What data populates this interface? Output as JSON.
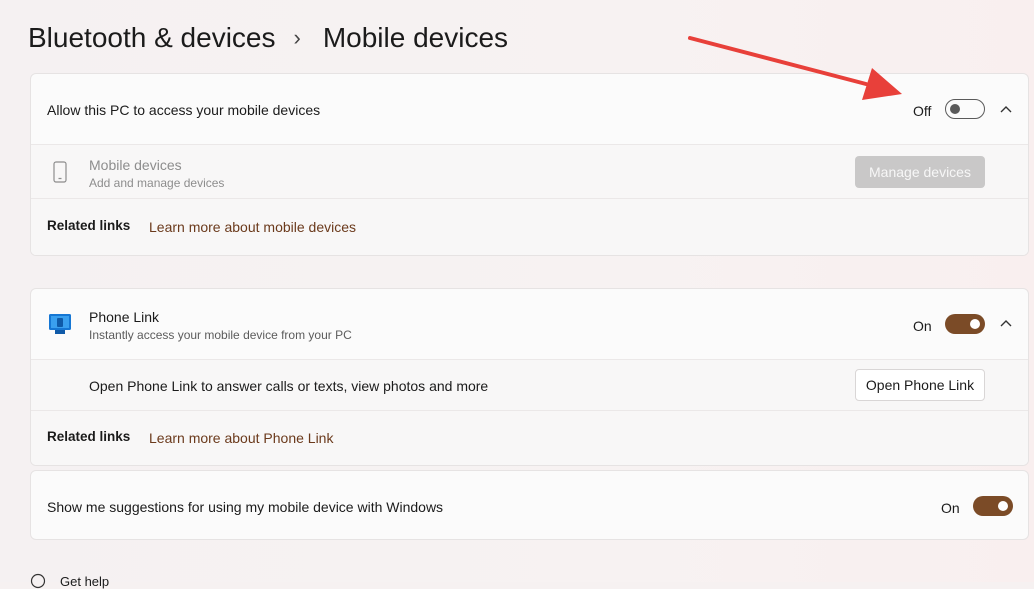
{
  "breadcrumb": {
    "parent": "Bluetooth & devices",
    "separator": "›",
    "current": "Mobile devices"
  },
  "access_card": {
    "label": "Allow this PC to access your mobile devices",
    "toggle_state": "Off",
    "mobile_devices": {
      "title": "Mobile devices",
      "subtitle": "Add and manage devices",
      "button": "Manage devices"
    },
    "related": {
      "label": "Related links",
      "link": "Learn more about mobile devices"
    }
  },
  "phone_link_card": {
    "title": "Phone Link",
    "subtitle": "Instantly access your mobile device from your PC",
    "toggle_state": "On",
    "open_row": {
      "text": "Open Phone Link to answer calls or texts, view photos and more",
      "button": "Open Phone Link"
    },
    "related": {
      "label": "Related links",
      "link": "Learn more about Phone Link"
    }
  },
  "suggestions_card": {
    "label": "Show me suggestions for using my mobile device with Windows",
    "toggle_state": "On"
  },
  "footer": {
    "get_help": "Get help"
  },
  "colors": {
    "accent": "#7b4b27",
    "arrow": "#e8403a",
    "link": "#6b3a1c"
  }
}
